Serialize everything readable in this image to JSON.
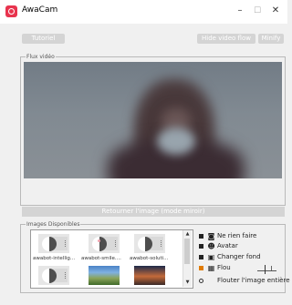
{
  "window": {
    "title": "AwaCam",
    "minimize_glyph": "–",
    "maximize_glyph": "☐",
    "close_glyph": "✕"
  },
  "toolbar": {
    "tutorial_label": "Tutoriel",
    "hide_video_flow_label": "Hide video flow",
    "minify_label": "Minify"
  },
  "video_group": {
    "label": "Flux vidéo"
  },
  "flip_button": {
    "label": "Retourner l'image (mode miroir)"
  },
  "images_group": {
    "label": "Images Disponibles",
    "thumbnails": [
      {
        "caption": "awabot-intellig...",
        "kind": "device"
      },
      {
        "caption": "awabot-smile....",
        "kind": "device"
      },
      {
        "caption": "awabot-soluti...",
        "kind": "device"
      },
      {
        "caption": "",
        "kind": "device"
      },
      {
        "caption": "",
        "kind": "landscape"
      },
      {
        "caption": "",
        "kind": "sunset"
      }
    ],
    "scroll_up_glyph": "▲",
    "scroll_down_glyph": "▼"
  },
  "options": [
    {
      "label": "Ne rien faire",
      "icon": "camera-icon",
      "glyph": "◙"
    },
    {
      "label": "Avatar",
      "icon": "user-icon",
      "glyph": "☻"
    },
    {
      "label": "Changer fond",
      "icon": "image-icon",
      "glyph": "▣"
    },
    {
      "label": "Flou",
      "icon": "blur-icon",
      "glyph": "▦"
    },
    {
      "label": "Flouter l'image entière",
      "icon": "radio-icon",
      "glyph": ""
    }
  ],
  "colors": {
    "accent": "#e8344e",
    "selected_mark": "#e07b00"
  }
}
